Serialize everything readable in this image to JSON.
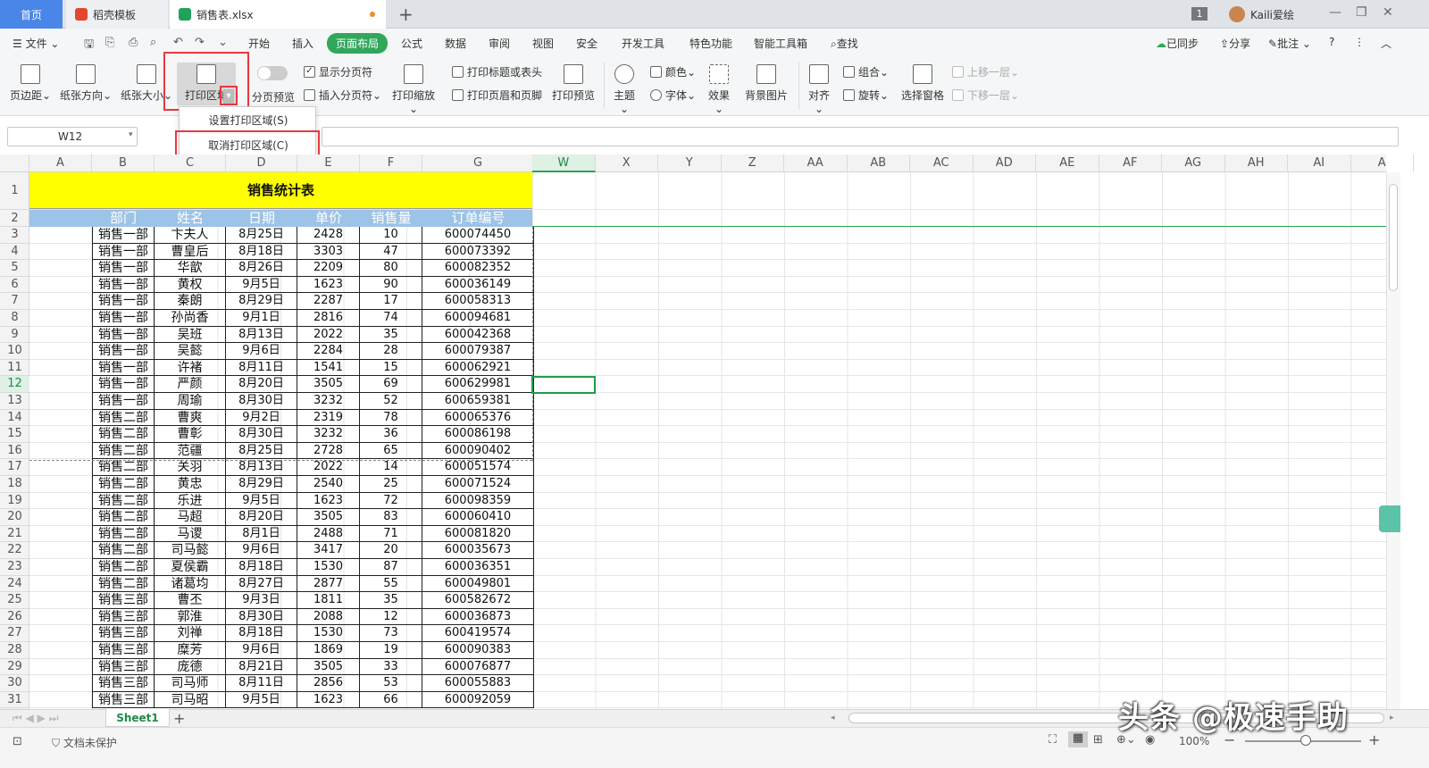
{
  "tabs": {
    "home": "首页",
    "template": "稻壳模板",
    "file": "销售表.xlsx"
  },
  "account": {
    "badge": "1",
    "user": "Kaili爱绘"
  },
  "menu": {
    "file": "文件",
    "items": [
      "开始",
      "插入",
      "页面布局",
      "公式",
      "数据",
      "审阅",
      "视图",
      "安全",
      "开发工具",
      "特色功能",
      "智能工具箱"
    ],
    "active": "页面布局",
    "search": "查找",
    "sync": "已同步",
    "share": "分享",
    "comment": "批注"
  },
  "ribbon": {
    "margin": "页边距",
    "orientation": "纸张方向",
    "size": "纸张大小",
    "print_area": "打印区域",
    "show_breaks": "显示分页符",
    "page_preview": "分页预览",
    "insert_break": "插入分页符",
    "print_scale": "打印缩放",
    "print_titles": "打印标题或表头",
    "header_footer": "打印页眉和页脚",
    "print_preview": "打印预览",
    "theme": "主题",
    "color": "颜色",
    "font": "字体",
    "effect": "效果",
    "background": "背景图片",
    "align": "对齐",
    "group": "组合",
    "rotate": "旋转",
    "selection_pane": "选择窗格",
    "bring_forward": "上移一层",
    "send_backward": "下移一层"
  },
  "dropdown": {
    "set_area": "设置打印区域(S)",
    "cancel_area": "取消打印区域(C)"
  },
  "namebox": "W12",
  "columns": [
    "A",
    "B",
    "C",
    "D",
    "E",
    "F",
    "G",
    "W",
    "X",
    "Y",
    "Z",
    "AA",
    "AB",
    "AC",
    "AD",
    "AE",
    "AF",
    "AG",
    "AH",
    "AI",
    "A"
  ],
  "selected_column": "W",
  "selected_row": "12",
  "rows": [
    "1",
    "2",
    "3",
    "4",
    "5",
    "6",
    "7",
    "8",
    "9",
    "10",
    "11",
    "12",
    "13",
    "14",
    "15",
    "16",
    "17",
    "18",
    "19",
    "20",
    "21",
    "22",
    "23",
    "24",
    "25",
    "26",
    "27",
    "28",
    "29",
    "30",
    "31"
  ],
  "sheet": {
    "title": "销售统计表",
    "headers": [
      "部门",
      "姓名",
      "日期",
      "单价",
      "销售量",
      "订单编号"
    ],
    "data": [
      [
        "销售一部",
        "卞夫人",
        "8月25日",
        "2428",
        "10",
        "600074450"
      ],
      [
        "销售一部",
        "曹皇后",
        "8月18日",
        "3303",
        "47",
        "600073392"
      ],
      [
        "销售一部",
        "华歆",
        "8月26日",
        "2209",
        "80",
        "600082352"
      ],
      [
        "销售一部",
        "黄权",
        "9月5日",
        "1623",
        "90",
        "600036149"
      ],
      [
        "销售一部",
        "秦朗",
        "8月29日",
        "2287",
        "17",
        "600058313"
      ],
      [
        "销售一部",
        "孙尚香",
        "9月1日",
        "2816",
        "74",
        "600094681"
      ],
      [
        "销售一部",
        "吴班",
        "8月13日",
        "2022",
        "35",
        "600042368"
      ],
      [
        "销售一部",
        "吴懿",
        "9月6日",
        "2284",
        "28",
        "600079387"
      ],
      [
        "销售一部",
        "许褚",
        "8月11日",
        "1541",
        "15",
        "600062921"
      ],
      [
        "销售一部",
        "严颜",
        "8月20日",
        "3505",
        "69",
        "600629981"
      ],
      [
        "销售一部",
        "周瑜",
        "8月30日",
        "3232",
        "52",
        "600659381"
      ],
      [
        "销售二部",
        "曹爽",
        "9月2日",
        "2319",
        "78",
        "600065376"
      ],
      [
        "销售二部",
        "曹彰",
        "8月30日",
        "3232",
        "36",
        "600086198"
      ],
      [
        "销售二部",
        "范疆",
        "8月25日",
        "2728",
        "65",
        "600090402"
      ],
      [
        "销售二部",
        "关羽",
        "8月13日",
        "2022",
        "14",
        "600051574"
      ],
      [
        "销售二部",
        "黄忠",
        "8月29日",
        "2540",
        "25",
        "600071524"
      ],
      [
        "销售二部",
        "乐进",
        "9月5日",
        "1623",
        "72",
        "600098359"
      ],
      [
        "销售二部",
        "马超",
        "8月20日",
        "3505",
        "83",
        "600060410"
      ],
      [
        "销售二部",
        "马谡",
        "8月1日",
        "2488",
        "71",
        "600081820"
      ],
      [
        "销售二部",
        "司马懿",
        "9月6日",
        "3417",
        "20",
        "600035673"
      ],
      [
        "销售二部",
        "夏侯霸",
        "8月18日",
        "1530",
        "87",
        "600036351"
      ],
      [
        "销售二部",
        "诸葛均",
        "8月27日",
        "2877",
        "55",
        "600049801"
      ],
      [
        "销售三部",
        "曹丕",
        "9月3日",
        "1811",
        "35",
        "600582672"
      ],
      [
        "销售三部",
        "郭淮",
        "8月30日",
        "2088",
        "12",
        "600036873"
      ],
      [
        "销售三部",
        "刘禅",
        "8月18日",
        "1530",
        "73",
        "600419574"
      ],
      [
        "销售三部",
        "糜芳",
        "9月6日",
        "1869",
        "19",
        "600090383"
      ],
      [
        "销售三部",
        "庞德",
        "8月21日",
        "3505",
        "33",
        "600076877"
      ],
      [
        "销售三部",
        "司马师",
        "8月11日",
        "2856",
        "53",
        "600055883"
      ],
      [
        "销售三部",
        "司马昭",
        "9月5日",
        "1623",
        "66",
        "600092059"
      ]
    ]
  },
  "sheet_tab": "Sheet1",
  "status": {
    "protect": "文档未保护",
    "zoom": "100%"
  },
  "watermark": "头条 @极速手助",
  "colors": {
    "accent": "#30a75a",
    "title_fill": "#ffff00",
    "header_fill": "#9dc3e6",
    "highlight": "#e8383d"
  }
}
